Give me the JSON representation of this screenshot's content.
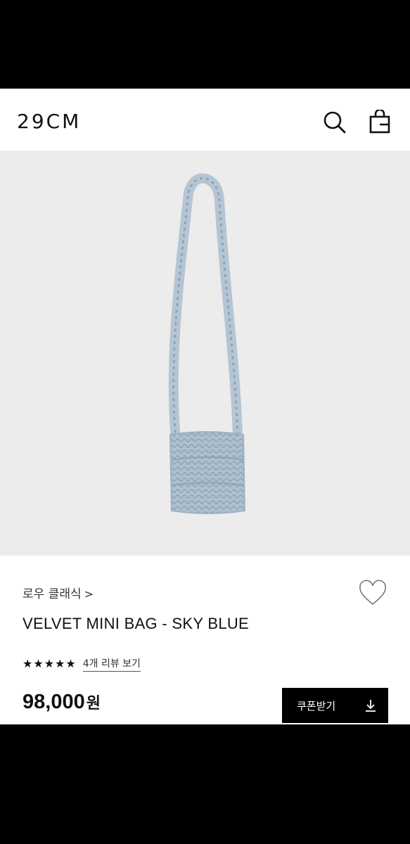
{
  "header": {
    "logo": "29CM",
    "icons": [
      "search-icon",
      "shopping-bag-icon"
    ]
  },
  "product": {
    "brand": "로우 클래식",
    "brand_chevron": ">",
    "title": "VELVET MINI BAG - SKY BLUE",
    "rating_stars": 5,
    "review_link": "4개 리뷰 보기",
    "price": "98,000",
    "price_unit": "원",
    "coupon_button": "쿠폰받기"
  },
  "colors": {
    "hero_background": "#ececec",
    "bag_color": "#a9bccd",
    "button_background": "#000000"
  }
}
